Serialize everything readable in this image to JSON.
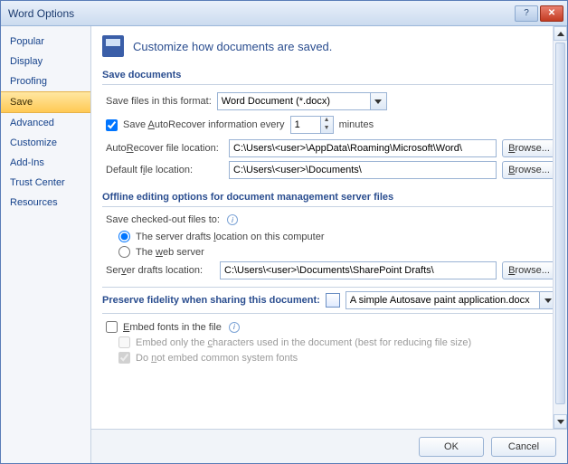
{
  "window": {
    "title": "Word Options"
  },
  "sidebar": {
    "items": [
      {
        "label": "Popular"
      },
      {
        "label": "Display"
      },
      {
        "label": "Proofing"
      },
      {
        "label": "Save",
        "selected": true
      },
      {
        "label": "Advanced"
      },
      {
        "label": "Customize"
      },
      {
        "label": "Add-Ins"
      },
      {
        "label": "Trust Center"
      },
      {
        "label": "Resources"
      }
    ]
  },
  "hero": {
    "text": "Customize how documents are saved."
  },
  "save_documents": {
    "title": "Save documents",
    "format_label": "Save files in this format:",
    "format_value": "Word Document (*.docx)",
    "autorecover_checked": true,
    "autorecover_label_pre": "Save ",
    "autorecover_label_u": "A",
    "autorecover_label_post": "utoRecover information every",
    "autorecover_value": "1",
    "autorecover_unit": "minutes",
    "autorecover_loc_label_pre": "Auto",
    "autorecover_loc_label_u": "R",
    "autorecover_loc_label_post": "ecover file location:",
    "autorecover_loc_value": "C:\\Users\\<user>\\AppData\\Roaming\\Microsoft\\Word\\",
    "default_loc_label_pre": "Default f",
    "default_loc_label_u": "i",
    "default_loc_label_post": "le location:",
    "default_loc_value": "C:\\Users\\<user>\\Documents\\",
    "browse_label": "Browse..."
  },
  "offline": {
    "title": "Offline editing options for document management server files",
    "checked_out_label": "Save checked-out files to:",
    "opt1_pre": "The server drafts ",
    "opt1_u": "l",
    "opt1_post": "ocation on this computer",
    "opt2_pre": "The ",
    "opt2_u": "w",
    "opt2_post": "eb server",
    "server_drafts_label_pre": "Ser",
    "server_drafts_label_u": "v",
    "server_drafts_label_post": "er drafts location:",
    "server_drafts_value": "C:\\Users\\<user>\\Documents\\SharePoint Drafts\\",
    "browse_label": "Browse..."
  },
  "preserve": {
    "title": "Preserve fidelity when sharing this document:",
    "doc_value": "A simple Autosave paint application.docx"
  },
  "embed": {
    "embed_fonts_pre": "",
    "embed_fonts_u": "E",
    "embed_fonts_post": "mbed fonts in the file",
    "only_chars_pre": "Embed only the ",
    "only_chars_u": "c",
    "only_chars_post": "haracters used in the document (best for reducing file size)",
    "no_common_pre": "Do ",
    "no_common_u": "n",
    "no_common_post": "ot embed common system fonts"
  },
  "footer": {
    "ok": "OK",
    "cancel": "Cancel"
  }
}
